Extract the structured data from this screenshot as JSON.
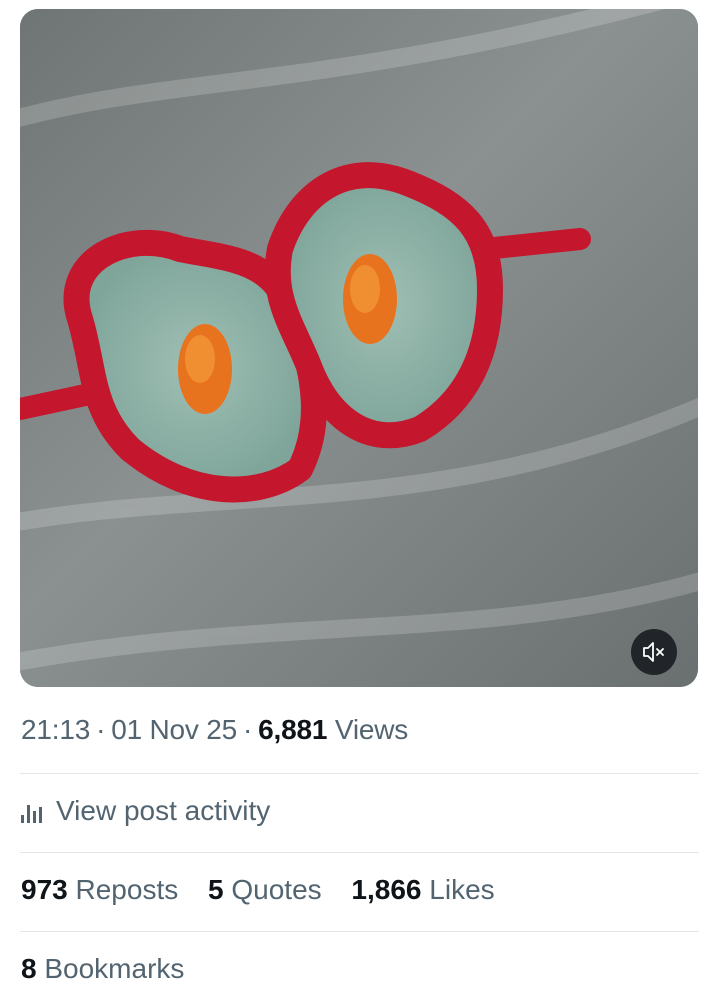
{
  "media": {
    "type": "video",
    "description_icon": "mute-icon"
  },
  "post_meta": {
    "time": "21:13",
    "date": "01 Nov 25",
    "views_count": "6,881",
    "views_label": "Views"
  },
  "activity": {
    "icon": "analytics-bars-icon",
    "label": "View post activity"
  },
  "stats": {
    "reposts_count": "973",
    "reposts_label": "Reposts",
    "quotes_count": "5",
    "quotes_label": "Quotes",
    "likes_count": "1,866",
    "likes_label": "Likes",
    "bookmarks_count": "8",
    "bookmarks_label": "Bookmarks"
  },
  "colors": {
    "text_primary": "#0f1419",
    "text_secondary": "#536471",
    "divider": "#e1e6ea",
    "petals": "#c4162c",
    "marigold": "#e8731f"
  }
}
